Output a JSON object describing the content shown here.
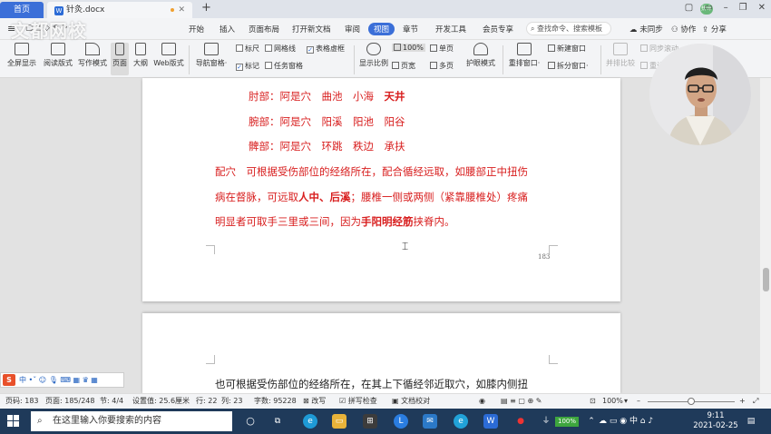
{
  "titlebar": {
    "home_tab": "首页",
    "doc_tab": "针灸.docx",
    "new_tab": "+",
    "avatar_text": "拼命",
    "controls": [
      "▢",
      "▭",
      "–",
      "❐",
      "✕"
    ]
  },
  "watermark": "文都网校",
  "menubar": {
    "items": [
      "开始",
      "插入",
      "页面布局",
      "打开新文档",
      "审阅",
      "视图",
      "章节",
      "开发工具",
      "会员专享"
    ],
    "active": "视图",
    "search_placeholder": "查找命令、搜索模板",
    "right": [
      "未同步",
      "协作",
      "分享"
    ]
  },
  "ribbon": {
    "buttons": [
      "全屏显示",
      "阅读版式",
      "写作模式",
      "页面",
      "大纲",
      "Web版式",
      "导航窗格·"
    ],
    "checks": [
      {
        "label": "标尺",
        "checked": false
      },
      {
        "label": "网格线",
        "checked": false
      },
      {
        "label": "表格虚框",
        "checked": true
      },
      {
        "label": "标记",
        "checked": true
      },
      {
        "label": "任务窗格",
        "checked": false
      }
    ],
    "zoom": {
      "label": "显示比例",
      "value": "100%",
      "single": "单页",
      "width": "页宽",
      "multi": "多页"
    },
    "eye": "护眼模式",
    "window": {
      "rearrange": "重排窗口·",
      "new": "新建窗口",
      "split": "拆分窗口·"
    },
    "compare": {
      "side": "并排比较",
      "sync": "同步滚动",
      "reset": "重设位置"
    }
  },
  "document": {
    "lines": [
      {
        "segments": [
          {
            "t": "肘部：阿是穴　曲池　小海　",
            "bold": false
          },
          {
            "t": "天井",
            "bold": true
          }
        ]
      },
      {
        "segments": [
          {
            "t": "腕部：阿是穴　阳溪　阳池　阳谷",
            "bold": false
          }
        ]
      },
      {
        "segments": [
          {
            "t": "髀部：阿是穴　环跳　秩边　承扶",
            "bold": false
          }
        ]
      },
      {
        "segments": [
          {
            "t": "配穴　可根据受伤部位的经络所在，配合循经远取，如腰部正中扭伤",
            "bold": false
          }
        ]
      },
      {
        "segments": [
          {
            "t": "病在督脉，可远取",
            "bold": false
          },
          {
            "t": "人中、后溪",
            "bold": true
          },
          {
            "t": "；腰椎一侧或两侧（紧靠腰椎处）疼痛",
            "bold": false
          }
        ]
      },
      {
        "segments": [
          {
            "t": "明显者可取手三里或三间，因为",
            "bold": false
          },
          {
            "t": "手阳明经筋",
            "bold": true
          },
          {
            "t": "挟脊内。",
            "bold": false
          }
        ]
      }
    ],
    "page_number": "183",
    "page2_text": "也可根据受伤部位的经络所在，在其上下循经邻近取穴，如膝内侧扭"
  },
  "ime": {
    "logo": "S",
    "label": "中"
  },
  "statusbar": {
    "page": "页码: 183",
    "pages": "页面: 185/248",
    "section": "节: 4/4",
    "setting": "设置值: 25.6厘米",
    "row": "行: 22",
    "col": "列: 23",
    "words": "字数: 95228",
    "revise": "改写",
    "spell": "拼写检查",
    "proof": "文档校对",
    "zoom": "100%",
    "zoom_level": 0.5
  },
  "taskbar": {
    "search_placeholder": "在这里输入你要搜索的内容",
    "battery": "100%",
    "time": "9:11",
    "date": "2021-02-25"
  },
  "colors": {
    "accent": "#3b6fd8",
    "doc_red": "#d81e1e",
    "taskbar": "#1f3a5a"
  }
}
